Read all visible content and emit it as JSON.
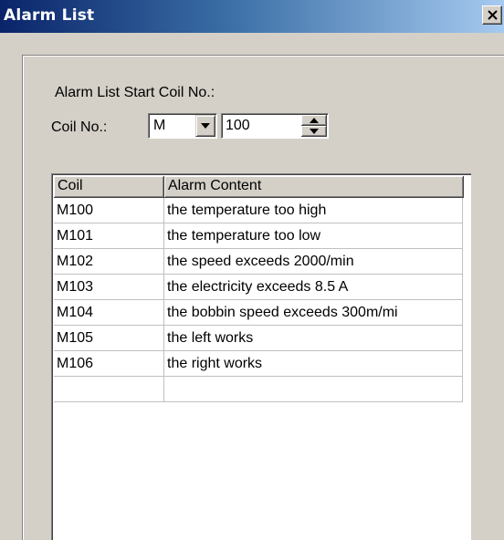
{
  "window": {
    "title": "Alarm List",
    "close_label": "close"
  },
  "group": {
    "caption": "Alarm List Start Coil No.:",
    "coil_label": "Coil No.:"
  },
  "coil_type": {
    "value": "M"
  },
  "coil_number": {
    "value": "100"
  },
  "table": {
    "columns": [
      "Coil",
      "Alarm Content"
    ],
    "rows": [
      {
        "coil": "M100",
        "content": "the temperature too high"
      },
      {
        "coil": "M101",
        "content": "the temperature too low"
      },
      {
        "coil": "M102",
        "content": "the speed exceeds 2000/min"
      },
      {
        "coil": "M103",
        "content": "the electricity exceeds 8.5 A"
      },
      {
        "coil": "M104",
        "content": "the bobbin speed exceeds 300m/mi"
      },
      {
        "coil": "M105",
        "content": "the left works"
      },
      {
        "coil": "M106",
        "content": "the right works"
      },
      {
        "coil": "",
        "content": ""
      }
    ]
  },
  "icons": {
    "close": "close-icon",
    "dropdown": "chevron-down-icon",
    "spin_up": "arrow-up-icon",
    "spin_down": "arrow-down-icon"
  }
}
